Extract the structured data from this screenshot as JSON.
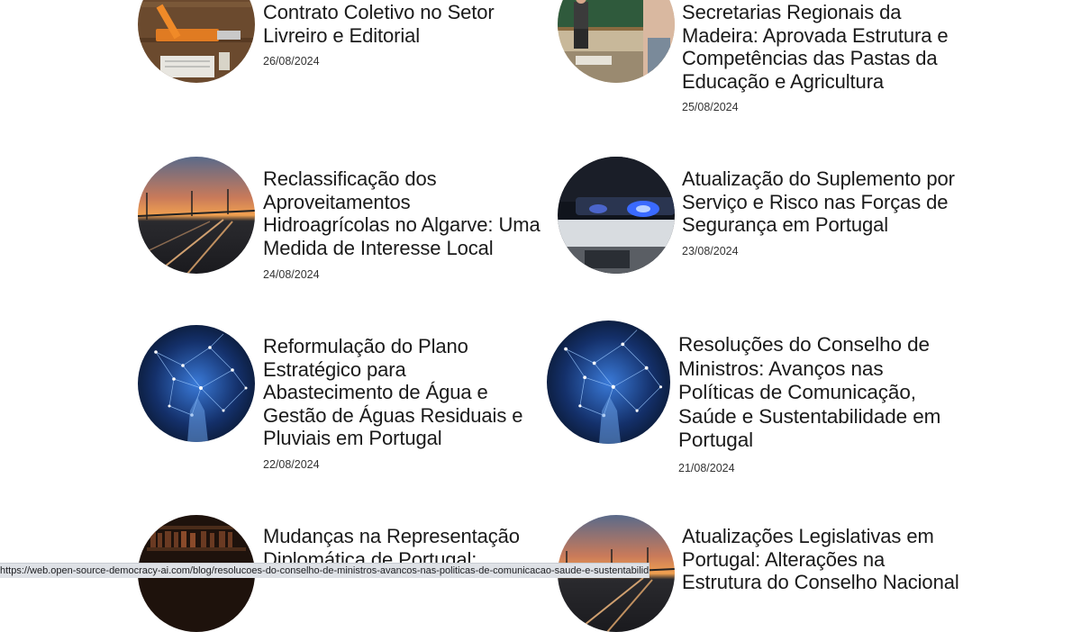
{
  "articles": [
    {
      "title_lines": [
        "Contrato Coletivo no Setor",
        "Livreiro e Editorial"
      ],
      "date": "26/08/2024",
      "image": "tools-on-wood-photo"
    },
    {
      "title_lines": [
        "Secretarias Regionais da",
        "Madeira: Aprovada Estrutura e",
        "Competências das Pastas da",
        "Educação e Agricultura"
      ],
      "date": "25/08/2024",
      "image": "classroom-photo"
    },
    {
      "title_lines": [
        "Reclassificação dos",
        "Aproveitamentos",
        "Hidroagrícolas no Algarve: Uma",
        "Medida de Interesse Local"
      ],
      "date": "24/08/2024",
      "image": "railway-sunset-photo"
    },
    {
      "title_lines": [
        "Atualização do Suplemento por",
        "Serviço e Risco nas Forças de",
        "Segurança em Portugal"
      ],
      "date": "23/08/2024",
      "image": "police-car-lights-photo"
    },
    {
      "title_lines": [
        "Reformulação do Plano",
        "Estratégico para",
        "Abastecimento de Água e",
        "Gestão de Águas Residuais e",
        "Pluviais em Portugal"
      ],
      "date": "22/08/2024",
      "image": "digital-network-hand-photo"
    },
    {
      "title_lines": [
        "Resoluções do Conselho de",
        "Ministros: Avanços nas",
        "Políticas de Comunicação,",
        "Saúde e Sustentabilidade em",
        "Portugal"
      ],
      "date": "21/08/2024",
      "image": "digital-network-hand-photo"
    },
    {
      "title_lines": [
        "Mudanças na Representação",
        "Diplomática de Portugal:"
      ],
      "date": "",
      "image": "library-shelves-photo"
    },
    {
      "title_lines": [
        "Atualizações Legislativas em",
        "Portugal: Alterações na",
        "Estrutura do Conselho Nacional"
      ],
      "date": "",
      "image": "railway-sunset-photo"
    }
  ],
  "status_url": "https://web.open-source-democracy-ai.com/blog/resolucoes-do-conselho-de-ministros-avancos-nas-politicas-de-comunicacao-saude-e-sustentabilidade-em-portugal"
}
